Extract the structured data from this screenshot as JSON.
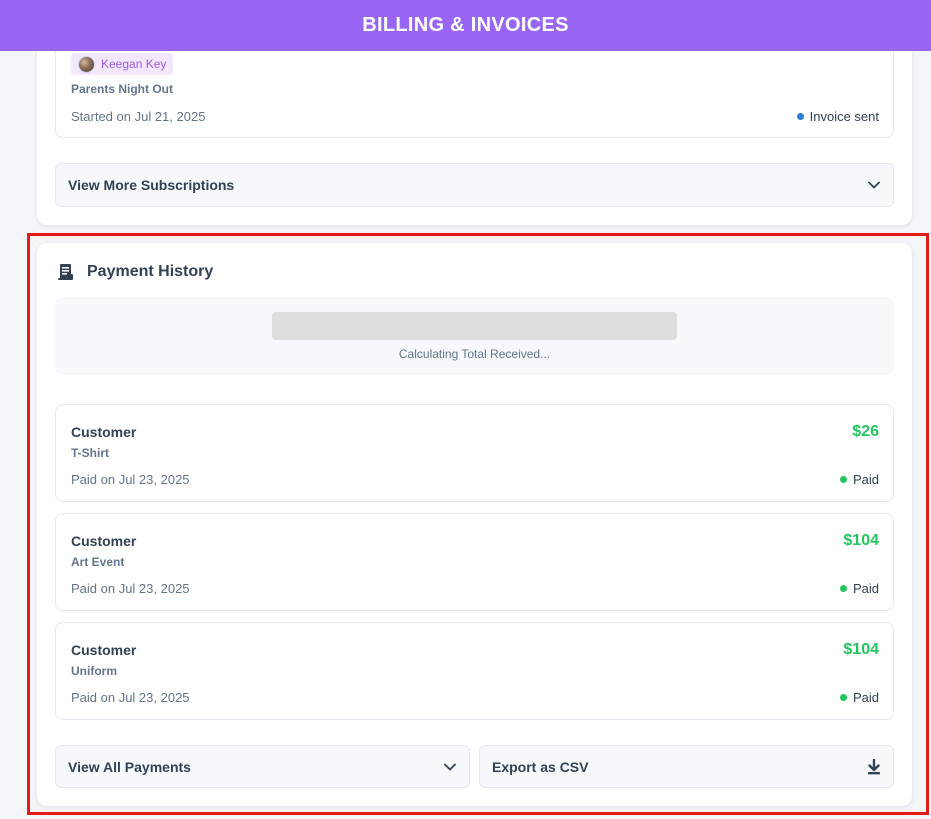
{
  "header": {
    "title": "BILLING & INVOICES"
  },
  "subscription": {
    "member_name": "Keegan Key",
    "event": "Parents Night Out",
    "started": "Started on Jul 21, 2025",
    "status": "Invoice sent",
    "view_more_label": "View More Subscriptions"
  },
  "payment_history": {
    "title": "Payment History",
    "total_loading_text": "Calculating Total Received...",
    "payments": [
      {
        "name": "Customer",
        "description": "T-Shirt",
        "date": "Paid on  Jul 23, 2025",
        "amount": "$26",
        "status": "Paid"
      },
      {
        "name": "Customer",
        "description": "Art Event",
        "date": "Paid on  Jul 23, 2025",
        "amount": "$104",
        "status": "Paid"
      },
      {
        "name": "Customer",
        "description": "Uniform",
        "date": "Paid on  Jul 23, 2025",
        "amount": "$104",
        "status": "Paid"
      }
    ],
    "view_all_label": "View All Payments",
    "export_label": "Export as CSV"
  },
  "colors": {
    "header_bg": "#9865f5",
    "paid_green": "#22c55e",
    "invoice_blue": "#2b7cd3",
    "highlight_red": "#e31b1b"
  },
  "icons": {
    "receipt": "receipt-icon",
    "chevron": "chevron-down-icon",
    "download": "download-icon"
  }
}
